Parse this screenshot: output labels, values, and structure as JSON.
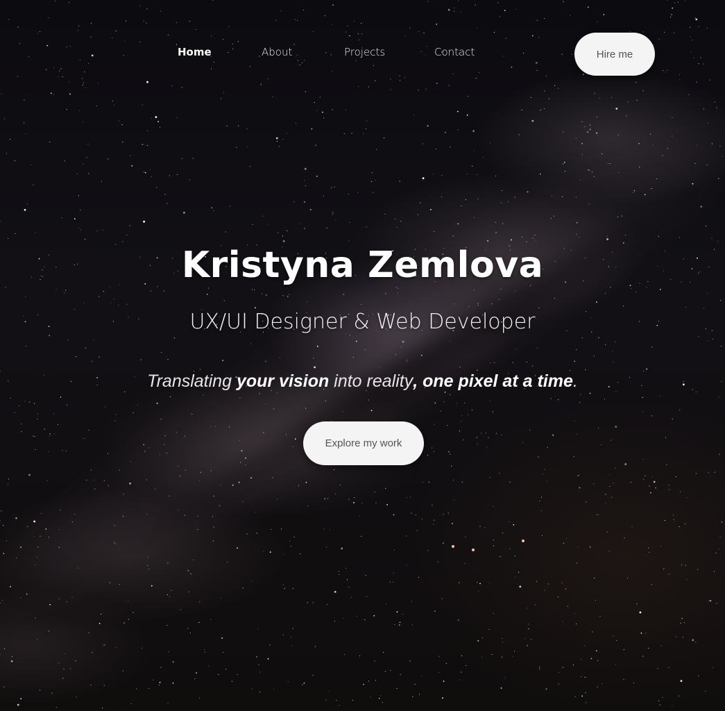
{
  "nav": {
    "items": [
      {
        "label": "Home",
        "active": true
      },
      {
        "label": "About",
        "active": false
      },
      {
        "label": "Projects",
        "active": false
      },
      {
        "label": "Contact",
        "active": false
      }
    ],
    "cta_label": "Hire me"
  },
  "hero": {
    "name": "Kristyna Zemlova",
    "role": "UX/UI Designer & Web Developer",
    "tagline": {
      "part1": "Translating ",
      "emph1": "your vision",
      "part2": " into reality",
      "sep": ", ",
      "emph2": "one pixel at a time",
      "end": "."
    },
    "cta_label": "Explore my work"
  },
  "colors": {
    "button_bg": "#f5f4f4",
    "button_text": "#555258",
    "text": "#ffffff"
  }
}
